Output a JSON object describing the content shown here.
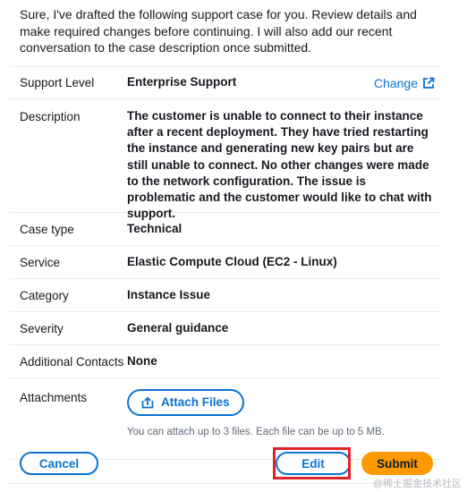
{
  "intro_text": "Sure, I've drafted the following support case for you. Review details and make required changes before continuing. I will also add our recent conversation to the case description once submitted.",
  "support_level": {
    "label": "Support Level",
    "value": "Enterprise Support",
    "change_link": "Change",
    "link_icon": "external-link-icon"
  },
  "description": {
    "label": "Description",
    "value": "The customer is unable to connect to their instance after a recent deployment. They have tried restarting the instance and generating new key pairs but are still unable to connect. No other changes were made to the network configuration. The issue is problematic and the customer would like to chat with support."
  },
  "fields": [
    {
      "label": "Case type",
      "value": "Technical"
    },
    {
      "label": "Service",
      "value": "Elastic Compute Cloud (EC2 - Linux)"
    },
    {
      "label": "Category",
      "value": "Instance Issue"
    },
    {
      "label": "Severity",
      "value": "General guidance"
    },
    {
      "label": "Additional Contacts",
      "value": "None"
    }
  ],
  "attachments": {
    "label": "Attachments",
    "button_label": "Attach Files",
    "button_icon": "upload-icon",
    "hint": "You can attach up to 3 files. Each file can be up to 5 MB."
  },
  "footer": {
    "cancel_label": "Cancel",
    "edit_label": "Edit",
    "submit_label": "Submit"
  },
  "watermark": "@稀土掘金技术社区",
  "colors": {
    "link": "#0972d3",
    "submit": "#ff9900",
    "highlight": "#e0242b",
    "border": "#e9ebed"
  }
}
